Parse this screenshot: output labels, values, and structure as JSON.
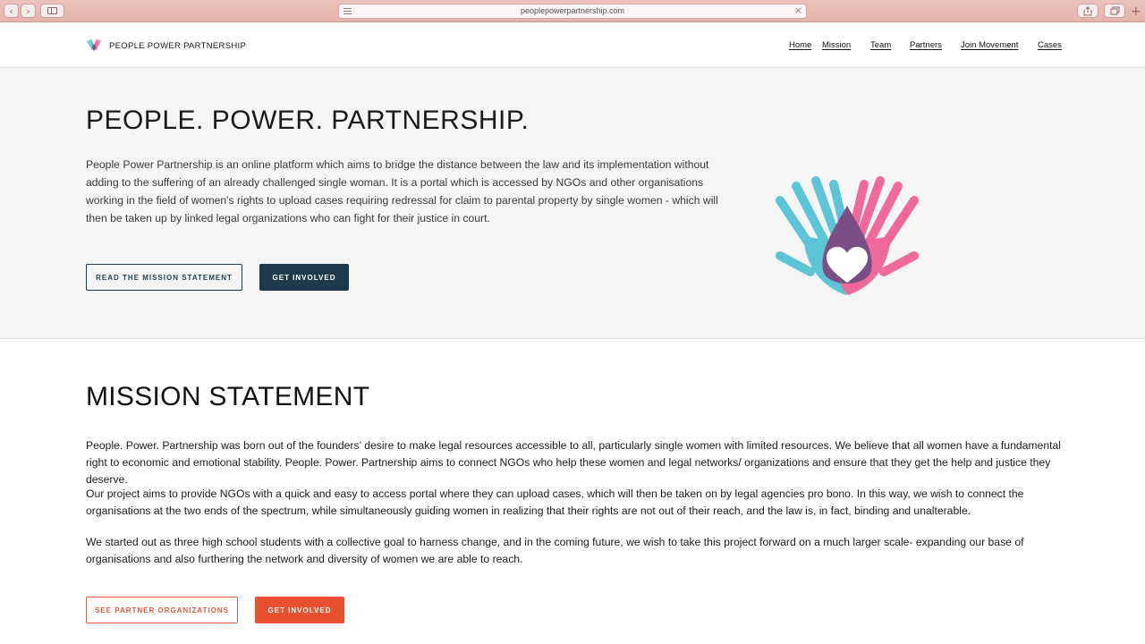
{
  "browser": {
    "url": "peoplepowerpartnership.com"
  },
  "header": {
    "brand_name": "PEOPLE POWER PARTNERSHIP",
    "nav": [
      "Home",
      "Mission",
      "Team",
      "Partners",
      "Join Movement",
      "Cases"
    ]
  },
  "hero": {
    "title": "PEOPLE. POWER. PARTNERSHIP.",
    "description": "People Power Partnership is an online platform which aims to bridge the distance between the law and its implementation without adding to the suffering of an already challenged single woman. It is a portal which is accessed by NGOs and other organisations working in the field of women's rights to upload cases requiring redressal for claim to parental property by single women - which will then be taken up by linked legal organizations who can fight for their justice in court.",
    "primary_button": "READ THE MISSION STATEMENT",
    "secondary_button": "GET INVOLVED"
  },
  "mission": {
    "title": "MISSION STATEMENT",
    "paragraphs": [
      "People. Power. Partnership was born out of the founders’ desire to make legal resources accessible to all, particularly single women with limited resources. We believe that all women have a fundamental right to economic and emotional stability. People. Power. Partnership aims to connect NGOs who help these women and legal networks/ organizations and ensure that they get the help and justice they deserve.",
      "Our project aims to provide NGOs with a quick and easy to access portal where they can upload cases, which will then be taken on by legal agencies pro bono. In this way, we wish to connect the organisations at the two ends of the spectrum, while simultaneously guiding women in realizing that their rights are not out of their reach, and the law is, in fact, binding and unalterable.",
      "We started out as three high school students with a collective goal to harness change, and in the coming future, we wish to take this project forward on a much larger scale- expanding our base of organisations and also furthering the network and diversity of women we are able to reach."
    ],
    "partner_button": "SEE PARTNER ORGANIZATIONS",
    "involved_button": "GET INVOLVED"
  },
  "colors": {
    "navy": "#1e3a4c",
    "accent_red": "#e8502f",
    "hand_cyan": "#5cc6d6",
    "hand_pink": "#ef6a9a",
    "overlap_purple": "#7a4f86"
  },
  "icons": [
    "back-icon",
    "forward-icon",
    "sidebar-icon",
    "share-icon",
    "tabs-icon",
    "new-tab-icon",
    "close-icon",
    "hands-heart-logo"
  ]
}
